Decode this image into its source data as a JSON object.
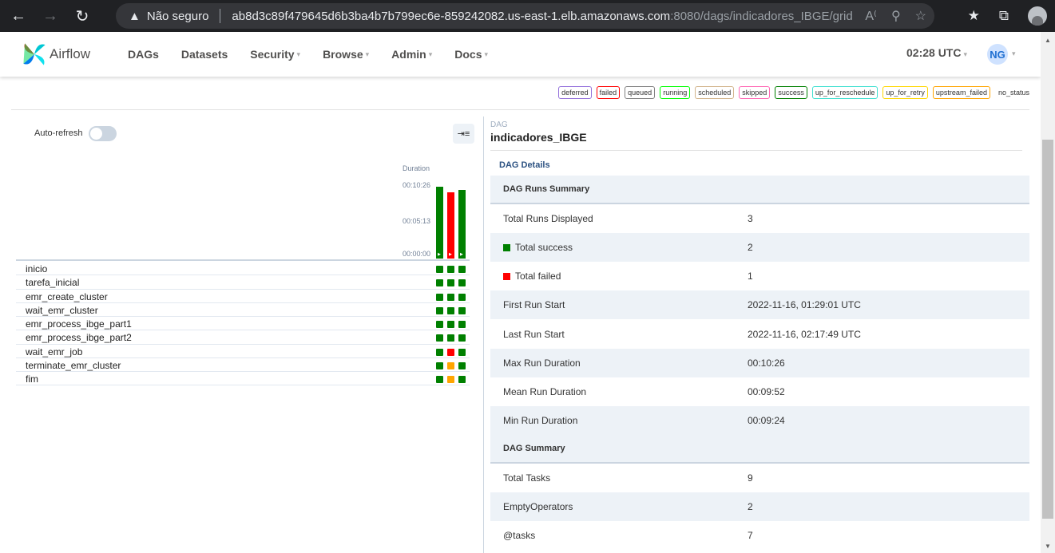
{
  "browser": {
    "security_label": "Não seguro",
    "url_host": "ab8d3c89f479645d6b3ba4b7b799ec6e-859242082.us-east-1.elb.amazonaws.com",
    "url_path": ":8080/dags/indicadores_IBGE/grid"
  },
  "nav": {
    "brand": "Airflow",
    "items": [
      "DAGs",
      "Datasets",
      "Security",
      "Browse",
      "Admin",
      "Docs"
    ],
    "time": "02:28 UTC",
    "user_initials": "NG"
  },
  "legend": [
    {
      "label": "deferred",
      "color": "#9370db"
    },
    {
      "label": "failed",
      "color": "#ff0000"
    },
    {
      "label": "queued",
      "color": "#808080"
    },
    {
      "label": "running",
      "color": "#00ff00"
    },
    {
      "label": "scheduled",
      "color": "#d2b48c"
    },
    {
      "label": "skipped",
      "color": "#ff69b4"
    },
    {
      "label": "success",
      "color": "#008000"
    },
    {
      "label": "up_for_reschedule",
      "color": "#40e0d0"
    },
    {
      "label": "up_for_retry",
      "color": "#ffd700"
    },
    {
      "label": "upstream_failed",
      "color": "#ffa500"
    },
    {
      "label": "no_status",
      "color": ""
    }
  ],
  "grid": {
    "auto_refresh_label": "Auto-refresh",
    "duration_title": "Duration",
    "ticks": [
      "00:10:26",
      "00:05:13",
      "00:00:00"
    ],
    "runs": [
      {
        "duration_fraction": 0.98,
        "state": "success"
      },
      {
        "duration_fraction": 0.9,
        "state": "failed"
      },
      {
        "duration_fraction": 0.94,
        "state": "success"
      }
    ],
    "tasks": [
      {
        "name": "inicio",
        "states": [
          "success",
          "success",
          "success"
        ]
      },
      {
        "name": "tarefa_inicial",
        "states": [
          "success",
          "success",
          "success"
        ]
      },
      {
        "name": "emr_create_cluster",
        "states": [
          "success",
          "success",
          "success"
        ]
      },
      {
        "name": "wait_emr_cluster",
        "states": [
          "success",
          "success",
          "success"
        ]
      },
      {
        "name": "emr_process_ibge_part1",
        "states": [
          "success",
          "success",
          "success"
        ]
      },
      {
        "name": "emr_process_ibge_part2",
        "states": [
          "success",
          "success",
          "success"
        ]
      },
      {
        "name": "wait_emr_job",
        "states": [
          "success",
          "failed",
          "success"
        ]
      },
      {
        "name": "terminate_emr_cluster",
        "states": [
          "success",
          "upstream_failed",
          "success"
        ]
      },
      {
        "name": "fim",
        "states": [
          "success",
          "upstream_failed",
          "success"
        ]
      }
    ],
    "state_colors": {
      "success": "#008000",
      "failed": "#ff0000",
      "upstream_failed": "#ffa500"
    }
  },
  "details": {
    "small_label": "DAG",
    "dag_id": "indicadores_IBGE",
    "tab": "DAG Details",
    "rows": [
      {
        "type": "head",
        "key": "DAG Runs Summary",
        "value": ""
      },
      {
        "type": "row",
        "key": "Total Runs Displayed",
        "value": "3"
      },
      {
        "type": "row",
        "key": "Total success",
        "value": "2",
        "dot": "#008000"
      },
      {
        "type": "row",
        "key": "Total failed",
        "value": "1",
        "dot": "#ff0000"
      },
      {
        "type": "row",
        "key": "First Run Start",
        "value": "2022-11-16, 01:29:01 UTC"
      },
      {
        "type": "row",
        "key": "Last Run Start",
        "value": "2022-11-16, 02:17:49 UTC"
      },
      {
        "type": "row",
        "key": "Max Run Duration",
        "value": "00:10:26"
      },
      {
        "type": "row",
        "key": "Mean Run Duration",
        "value": "00:09:52"
      },
      {
        "type": "row",
        "key": "Min Run Duration",
        "value": "00:09:24"
      },
      {
        "type": "head",
        "key": "DAG Summary",
        "value": ""
      },
      {
        "type": "row",
        "key": "Total Tasks",
        "value": "9"
      },
      {
        "type": "row",
        "key": "EmptyOperators",
        "value": "2"
      },
      {
        "type": "row",
        "key": "@tasks",
        "value": "7"
      }
    ]
  }
}
